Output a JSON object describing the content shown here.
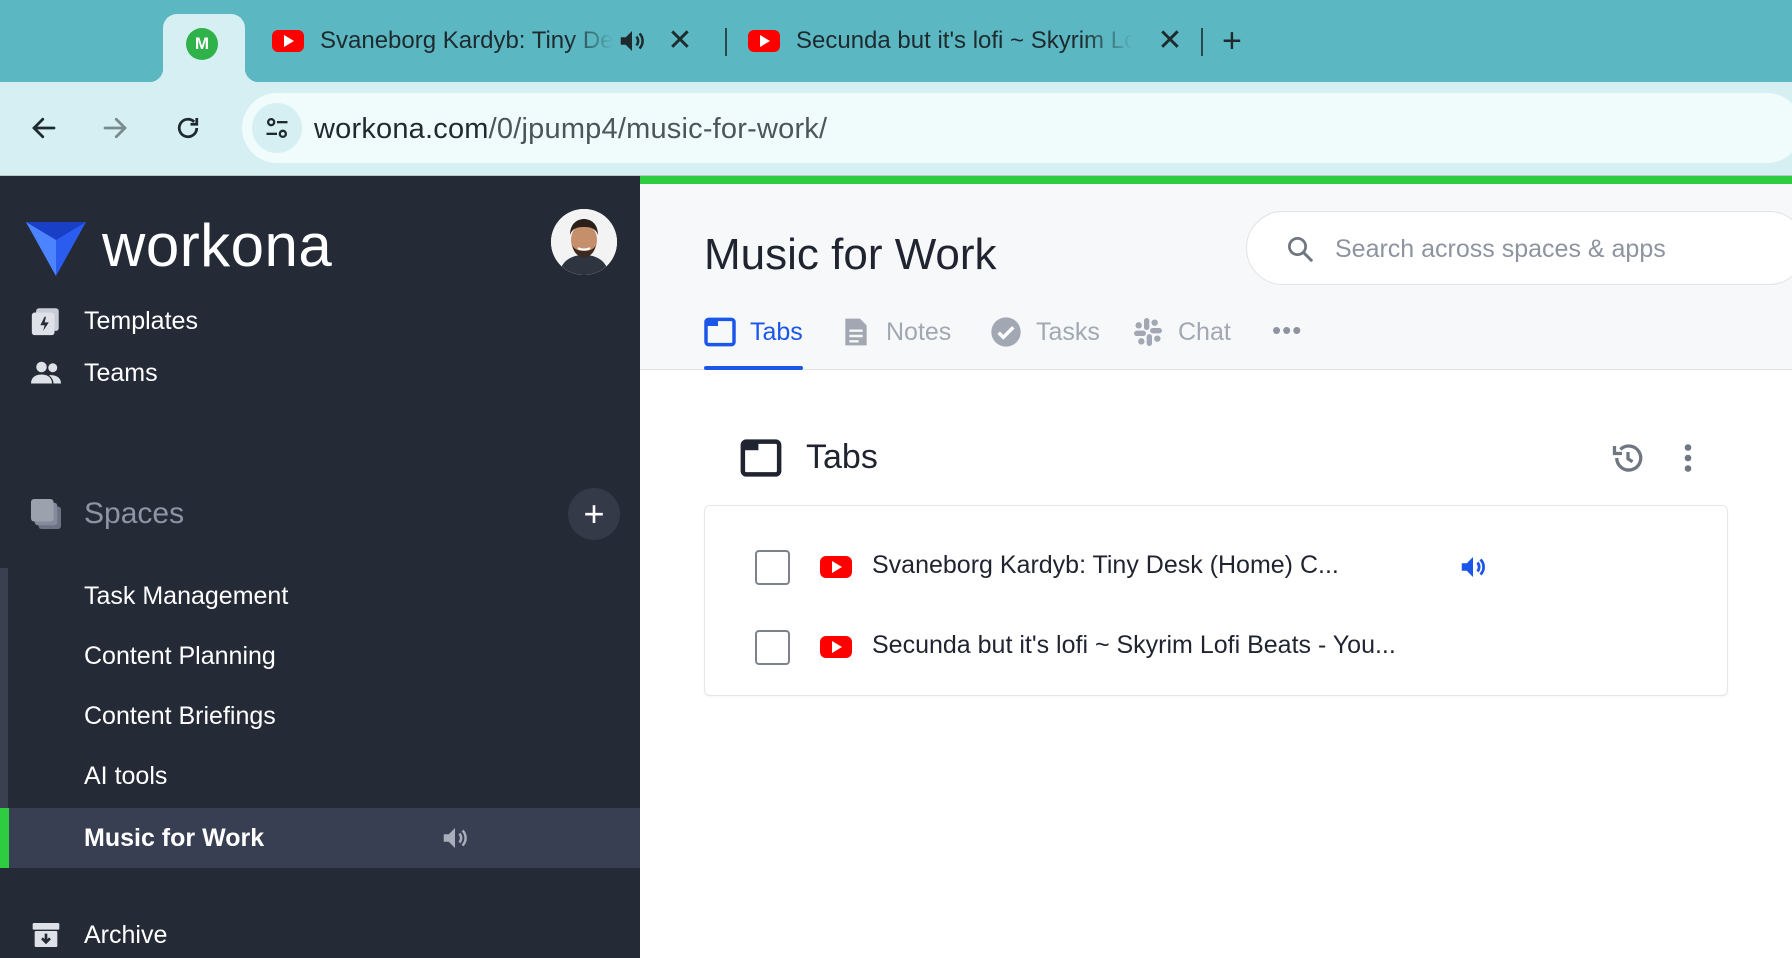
{
  "browser": {
    "profile_badge": "M",
    "tabs": [
      {
        "title": "Svaneborg Kardyb: Tiny Desk (Home) Concert",
        "favicon": "youtube-icon",
        "audible": true,
        "close": "✕"
      },
      {
        "title": "Secunda but it's lofi ~ Skyrim Lofi Beats - YouTube",
        "favicon": "youtube-icon",
        "audible": false,
        "close": "✕"
      }
    ],
    "new_tab": "+",
    "url_host": "workona.com",
    "url_path": "/0/jpump4/music-for-work/"
  },
  "sidebar": {
    "logo": "workona",
    "nav": [
      {
        "label": "Templates",
        "icon": "templates-icon"
      },
      {
        "label": "Teams",
        "icon": "teams-icon"
      }
    ],
    "spaces_label": "Spaces",
    "add_space": "+",
    "spaces": [
      {
        "label": "Task Management"
      },
      {
        "label": "Content Planning"
      },
      {
        "label": "Content Briefings"
      },
      {
        "label": "AI tools"
      },
      {
        "label": "Music for Work",
        "active": true,
        "audible": true
      }
    ],
    "archive_label": "Archive"
  },
  "main": {
    "title": "Music for Work",
    "search_placeholder": "Search across spaces & apps",
    "tabs": [
      {
        "label": "Tabs",
        "icon": "tabs-icon",
        "active": true
      },
      {
        "label": "Notes",
        "icon": "notes-icon"
      },
      {
        "label": "Tasks",
        "icon": "tasks-icon"
      },
      {
        "label": "Chat",
        "icon": "slack-icon"
      }
    ],
    "more": "•••",
    "section_title": "Tabs",
    "saved_tabs": [
      {
        "title": "Svaneborg Kardyb: Tiny Desk (Home) C...",
        "audible": true
      },
      {
        "title": "Secunda but it's lofi ~ Skyrim Lofi Beats - You..."
      }
    ]
  },
  "colors": {
    "accent_blue": "#1a56e8",
    "accent_green": "#2ecc40",
    "sidebar_bg": "#252a37",
    "chrome_bg": "#5bb8c2"
  }
}
